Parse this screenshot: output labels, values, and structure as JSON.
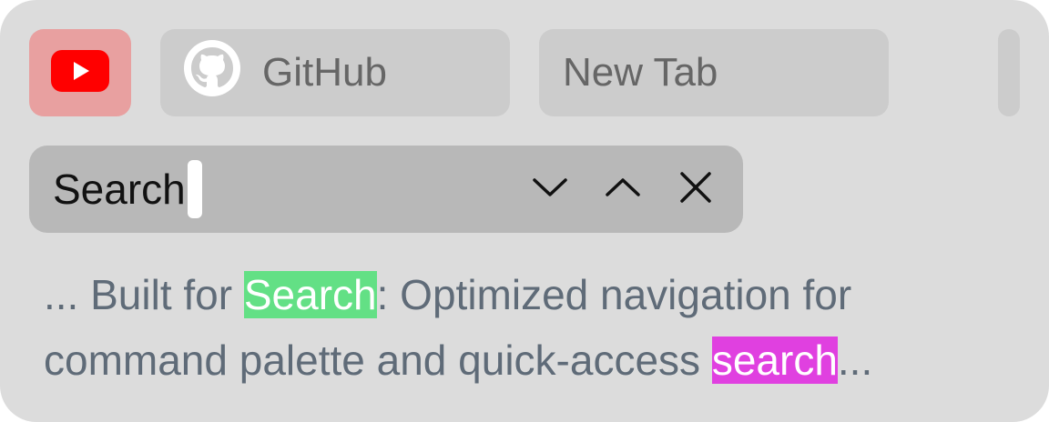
{
  "tabs": [
    {
      "label": "",
      "icon": "youtube-icon",
      "color": "#ff0000",
      "background": "#e8a0a0",
      "active": true
    },
    {
      "label": "GitHub",
      "icon": "github-icon"
    },
    {
      "label": "New Tab",
      "icon": null
    }
  ],
  "find_bar": {
    "query": "Search",
    "buttons": [
      "chevron-down-icon",
      "chevron-up-icon",
      "close-icon"
    ]
  },
  "snippet": {
    "line1_prefix": "... Built for ",
    "line1_match": "Search",
    "line1_suffix": ": Optimized navigation for",
    "line2_prefix": "command palette and quick-access ",
    "line2_match": "search",
    "line2_suffix": "...",
    "current_match_color": "#63e085",
    "other_match_color": "#e040e0"
  }
}
